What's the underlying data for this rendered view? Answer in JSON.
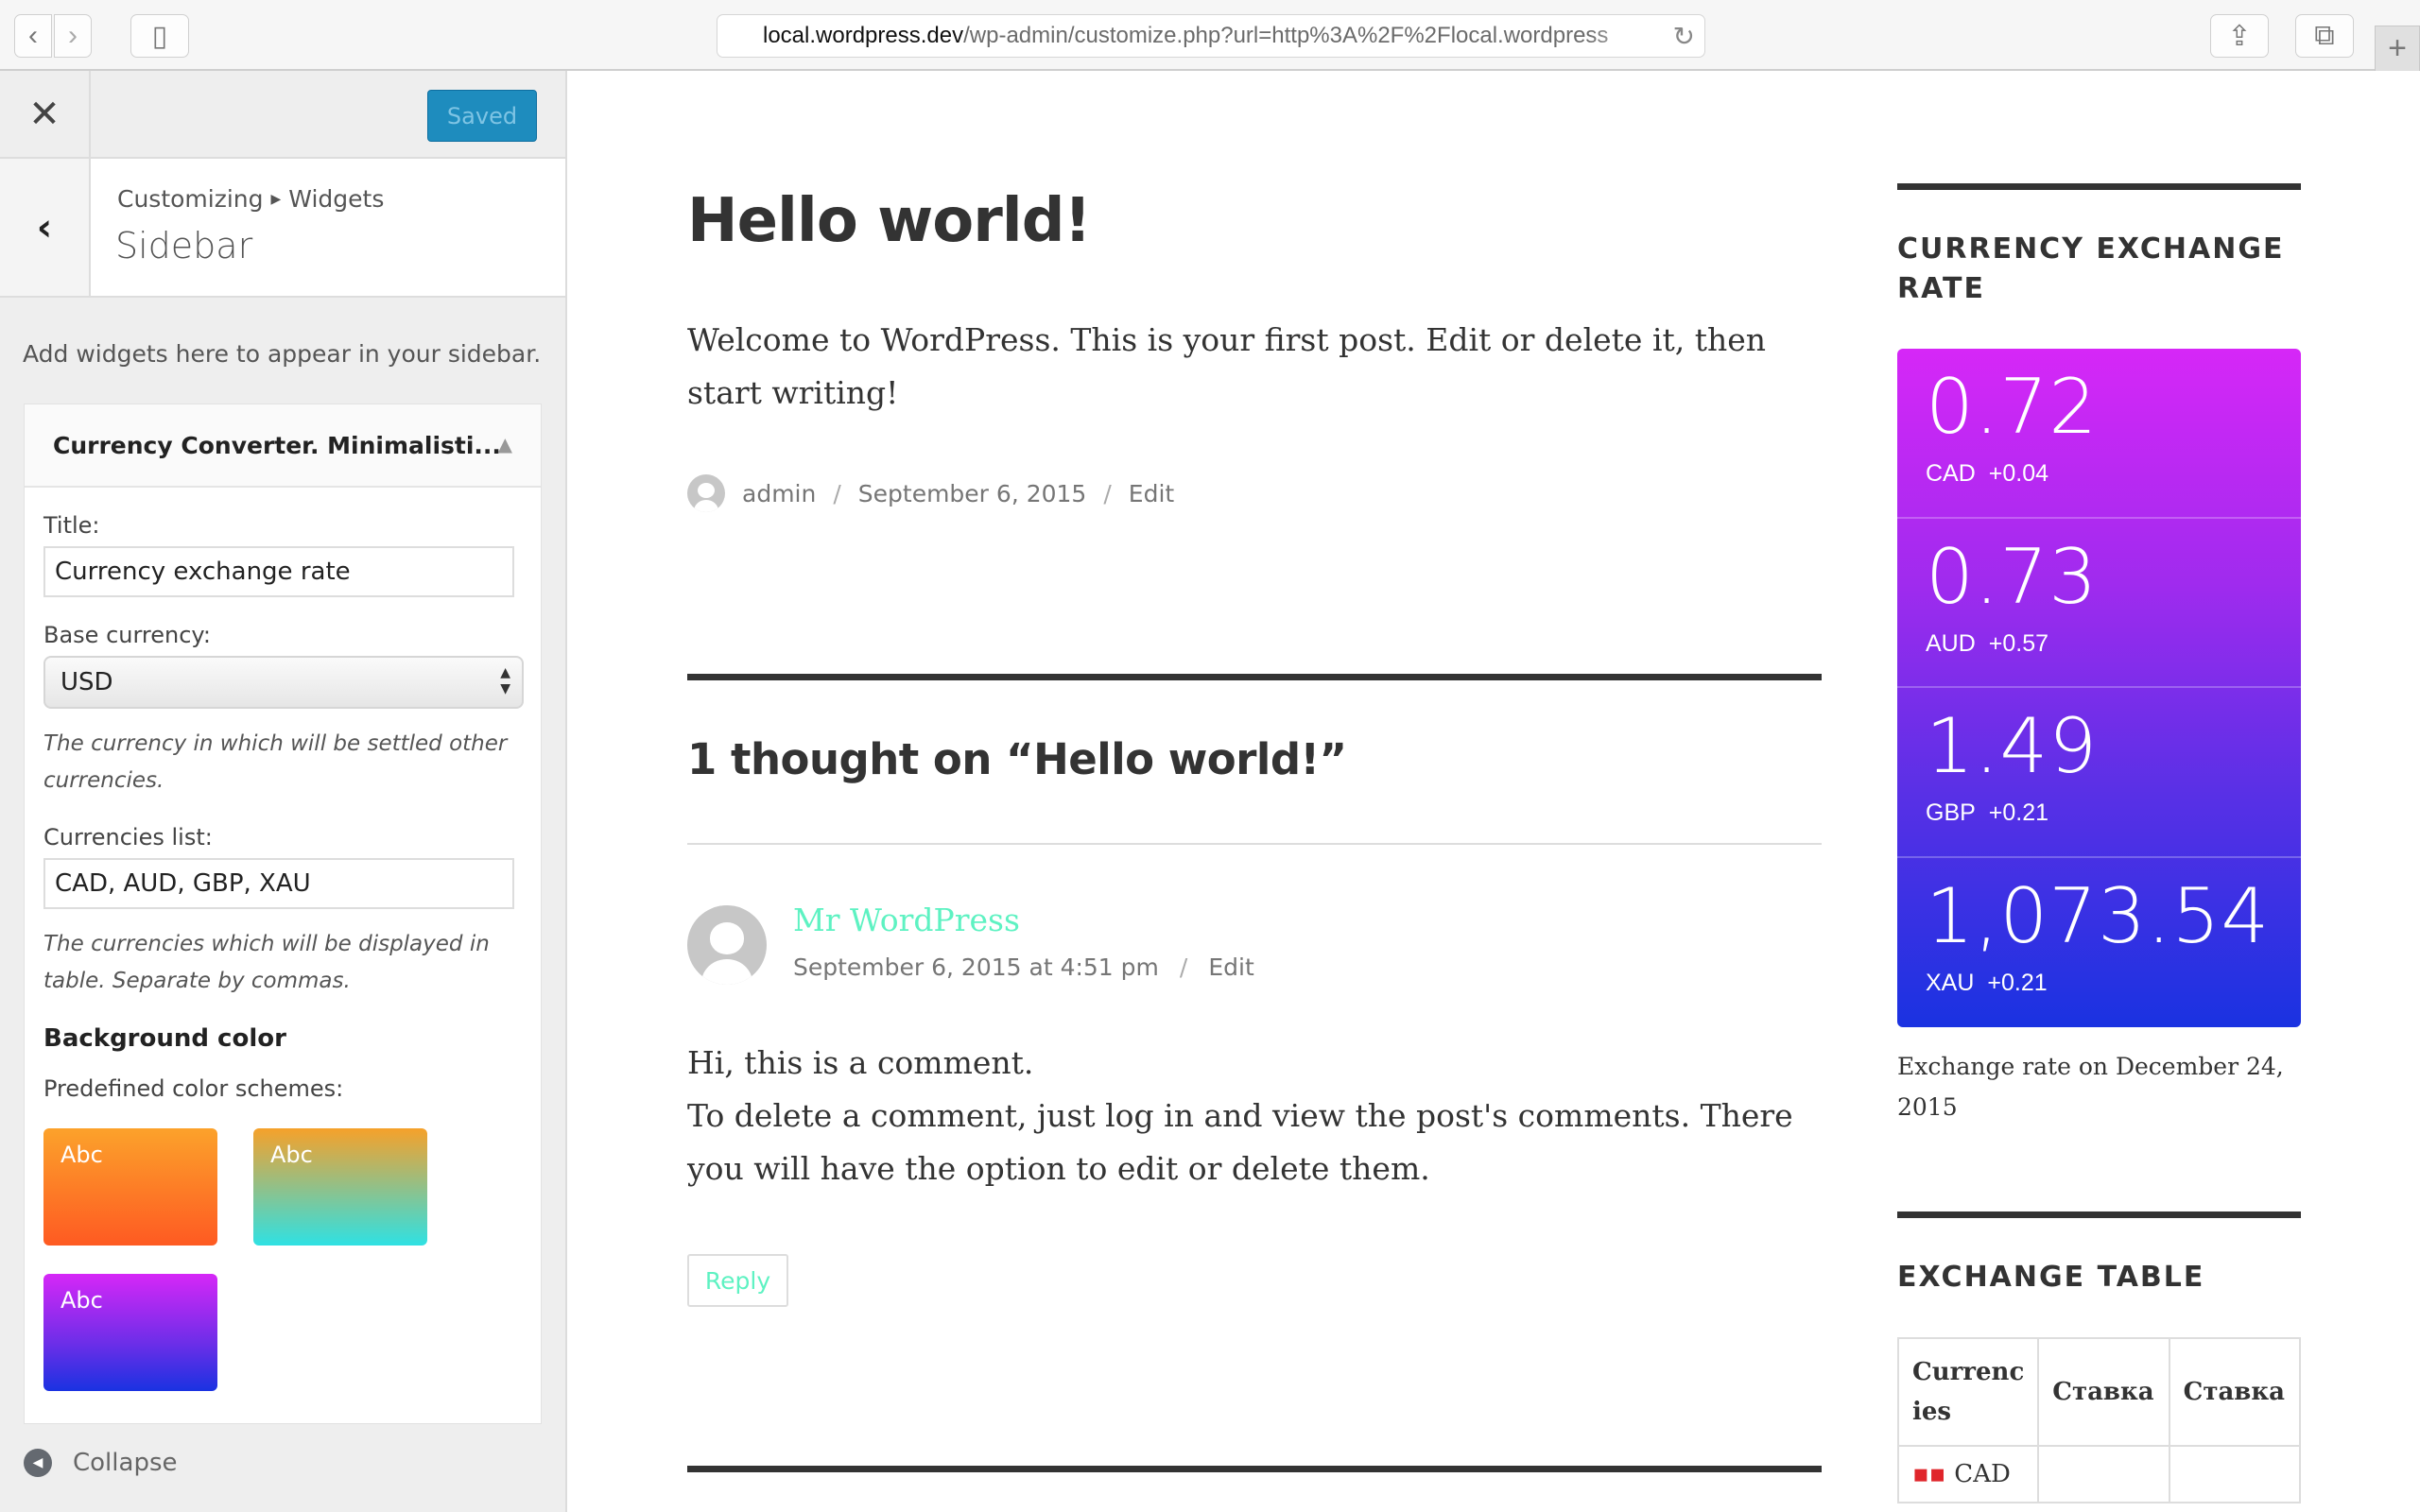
{
  "browser": {
    "url_host": "local.wordpress.dev",
    "url_path": "/wp-admin/customize.php?url=http%3A%2F%2Flocal.wordpress",
    "back_icon": "‹",
    "forward_icon": "›",
    "sidebar_icon": "▯",
    "reload_icon": "↻",
    "share_icon": "⇪",
    "tabs_icon": "⧉",
    "newtab_icon": "+"
  },
  "customizer": {
    "close_icon": "✕",
    "saved_label": "Saved",
    "back_icon": "‹",
    "breadcrumb": [
      "Customizing",
      "Widgets"
    ],
    "breadcrumb_sep": "▶",
    "section_title": "Sidebar",
    "description": "Add widgets here to appear in your sidebar.",
    "widget": {
      "title": "Currency Converter. Minimalisti...",
      "toggle_icon": "▲",
      "fields": {
        "title_label": "Title:",
        "title_value": "Currency exchange rate",
        "base_label": "Base currency:",
        "base_value": "USD",
        "base_help": "The currency in which will be settled other currencies.",
        "list_label": "Currencies list:",
        "list_value": "CAD, AUD, GBP, XAU",
        "list_help": "The currencies which will be displayed in table. Separate by commas.",
        "bg_heading": "Background color",
        "schemes_label": "Predefined color schemes:"
      },
      "swatches": [
        {
          "label": "Abc",
          "colors": [
            "#fca22b",
            "#fe5a22"
          ]
        },
        {
          "label": "Abc",
          "colors": [
            "#f6a12a",
            "#2fe1e3"
          ]
        },
        {
          "label": "Abc",
          "colors": [
            "#d627f7",
            "#1a32e1"
          ]
        }
      ]
    },
    "collapse_label": "Collapse",
    "accent": "#1e8cbe"
  },
  "preview": {
    "post_title": "Hello world!",
    "post_content": "Welcome to WordPress. This is your first post. Edit or delete it, then start writing!",
    "meta": {
      "author": "admin",
      "date": "September 6, 2015",
      "edit": "Edit",
      "sep": "/"
    },
    "comments_title": "1 thought on “Hello world!”",
    "comment": {
      "author": "Mr WordPress",
      "date": "September 6, 2015 at 4:51 pm",
      "edit": "Edit",
      "body_line1": "Hi, this is a comment.",
      "body_line2": "To delete a comment, just log in and view the post's comments. There you will have the option to edit or delete them.",
      "reply": "Reply"
    },
    "link_color": "#5ef2c2",
    "sidebar": {
      "rate_widget_title": "CURRENCY EXCHANGE RATE",
      "rates": [
        {
          "value": "0.72",
          "code": "CAD",
          "change": "+0.04"
        },
        {
          "value": "0.73",
          "code": "AUD",
          "change": "+0.57"
        },
        {
          "value": "1.49",
          "code": "GBP",
          "change": "+0.21"
        },
        {
          "value": "1,073.54",
          "code": "XAU",
          "change": "+0.21"
        }
      ],
      "rates_note": "Exchange rate on December 24, 2015",
      "table_widget_title": "EXCHANGE TABLE",
      "table_headers": [
        "Currenc ies",
        "Ставка",
        "Ставка"
      ],
      "table_first_cell": "CAD"
    }
  }
}
